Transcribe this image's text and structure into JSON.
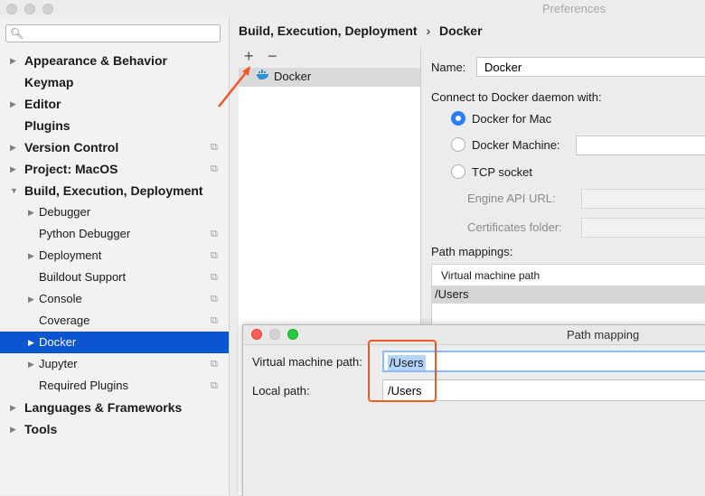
{
  "window": {
    "title": "Preferences"
  },
  "search": {
    "placeholder": "",
    "value": ""
  },
  "sidebar": {
    "items": [
      {
        "label": "Appearance & Behavior",
        "arrow": "▶",
        "bold": true,
        "copy": false
      },
      {
        "label": "Keymap",
        "arrow": "",
        "bold": true,
        "copy": false
      },
      {
        "label": "Editor",
        "arrow": "▶",
        "bold": true,
        "copy": false
      },
      {
        "label": "Plugins",
        "arrow": "",
        "bold": true,
        "copy": false
      },
      {
        "label": "Version Control",
        "arrow": "▶",
        "bold": true,
        "copy": true
      },
      {
        "label": "Project: MacOS",
        "arrow": "▶",
        "bold": true,
        "copy": true
      },
      {
        "label": "Build, Execution, Deployment",
        "arrow": "▼",
        "bold": true,
        "copy": false
      },
      {
        "label": "Debugger",
        "arrow": "▶",
        "bold": false,
        "copy": false
      },
      {
        "label": "Python Debugger",
        "arrow": "",
        "bold": false,
        "copy": true
      },
      {
        "label": "Deployment",
        "arrow": "▶",
        "bold": false,
        "copy": true
      },
      {
        "label": "Buildout Support",
        "arrow": "",
        "bold": false,
        "copy": true
      },
      {
        "label": "Console",
        "arrow": "▶",
        "bold": false,
        "copy": true
      },
      {
        "label": "Coverage",
        "arrow": "",
        "bold": false,
        "copy": true
      },
      {
        "label": "Docker",
        "arrow": "▶",
        "bold": false,
        "copy": false,
        "selected": true
      },
      {
        "label": "Jupyter",
        "arrow": "▶",
        "bold": false,
        "copy": true
      },
      {
        "label": "Required Plugins",
        "arrow": "",
        "bold": false,
        "copy": true
      },
      {
        "label": "Languages & Frameworks",
        "arrow": "▶",
        "bold": true,
        "copy": false
      },
      {
        "label": "Tools",
        "arrow": "▶",
        "bold": true,
        "copy": false
      }
    ]
  },
  "breadcrumb": {
    "parent": "Build, Execution, Deployment",
    "separator": "›",
    "current": "Docker"
  },
  "list": {
    "add_symbol": "+",
    "remove_symbol": "−",
    "items": [
      {
        "label": "Docker",
        "icon": "docker-whale-icon"
      }
    ]
  },
  "form": {
    "name_label": "Name:",
    "name_value": "Docker",
    "connect_label": "Connect to Docker daemon with:",
    "radio_mac": "Docker for Mac",
    "radio_machine": "Docker Machine:",
    "radio_tcp": "TCP socket",
    "engine_api_label": "Engine API URL:",
    "certs_label": "Certificates folder:",
    "path_mappings_label": "Path mappings:",
    "pm_column": "Virtual machine path",
    "pm_row_value": "/Users",
    "selected_option": "Docker for Mac"
  },
  "dialog": {
    "title": "Path mapping",
    "vm_label": "Virtual machine path:",
    "vm_value": "/Users",
    "local_label": "Local path:",
    "local_value": "/Users"
  },
  "colors": {
    "selection": "#0a55d0",
    "annotation": "#f05a2a",
    "radio_on": "#2a7df7"
  }
}
